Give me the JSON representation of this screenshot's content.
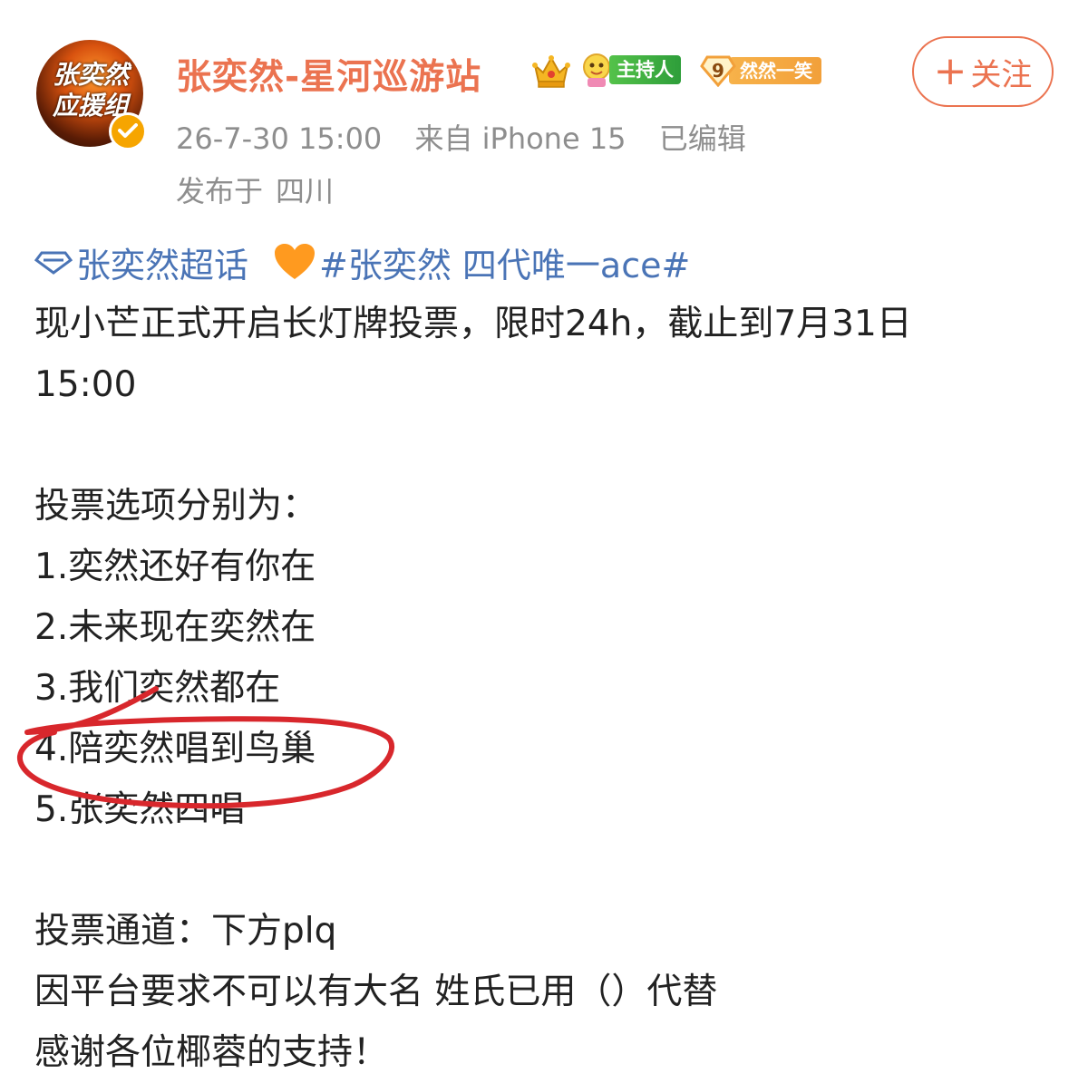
{
  "post": {
    "author": {
      "name": "张奕然-星河巡游站",
      "avatar_text": "张奕然应援组",
      "avatar_text_lines": [
        "张奕然",
        "应援组"
      ],
      "verified_icon": "verified-badge-icon",
      "badges": {
        "crown_icon": "crown-icon",
        "host_label": "主持人",
        "fan_level": "9",
        "fan_label": "然然一笑"
      }
    },
    "follow_label": "关注",
    "follow_icon": "plus-icon",
    "timestamp": "26-7-30 15:00",
    "source": "来自 iPhone 15",
    "edited": "已编辑",
    "location_prefix": "发布于",
    "location": "四川",
    "supertopic": "张奕然超话",
    "hashtag": "#张奕然 四代唯一ace#",
    "body": {
      "intro_line1": "现小芒正式开启长灯牌投票，限时24h，截止到7月31日",
      "intro_line2": "15:00",
      "options_header": "投票选项分别为：",
      "options": [
        "1.奕然还好有你在",
        "2.未来现在奕然在",
        "3.我们奕然都在",
        "4.陪奕然唱到鸟巢",
        "5.张奕然四唱"
      ],
      "channel": "投票通道：下方plq",
      "notice": "因平台要求不可以有大名 姓氏已用（）代替",
      "thanks": "感谢各位椰蓉的支持！"
    },
    "annotation_color": "#d8272c",
    "accent_color": "#eb7350",
    "link_color": "#4a74b6"
  }
}
